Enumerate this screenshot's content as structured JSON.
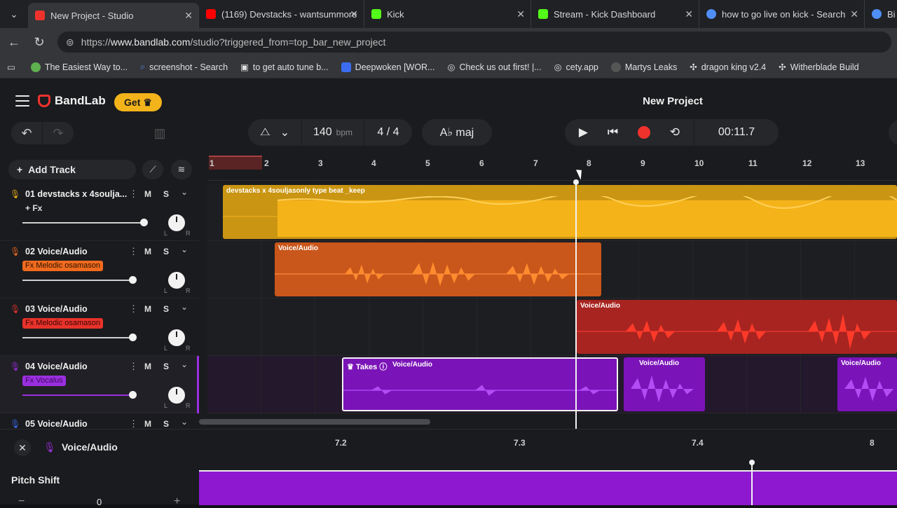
{
  "browser": {
    "tabs": [
      {
        "title": "New Project - Studio",
        "color": "#f0322d"
      },
      {
        "title": "(1169) Devstacks - wantsummore",
        "color": "#ff0000"
      },
      {
        "title": "Kick",
        "color": "#53fc18"
      },
      {
        "title": "Stream - Kick Dashboard",
        "color": "#53fc18"
      },
      {
        "title": "how to go live on kick - Search",
        "color": "#4f8ef7"
      },
      {
        "title": "Bi",
        "color": "#4f8ef7"
      }
    ],
    "url_prefix": "https://",
    "url_host": "www.bandlab.com",
    "url_path": "/studio?triggered_from=top_bar_new_project",
    "bookmarks": [
      {
        "label": "The Easiest Way to...",
        "color": "#5fb04f"
      },
      {
        "label": "screenshot - Search",
        "color": "#4f8ef7"
      },
      {
        "label": "to get auto tune b...",
        "color": "#cfcfcf"
      },
      {
        "label": "Deepwoken [WOR...",
        "color": "#3b6cf0"
      },
      {
        "label": "Check us out first! |...",
        "color": "#cfcfcf"
      },
      {
        "label": "cety.app",
        "color": "#cfcfcf"
      },
      {
        "label": "Martys Leaks",
        "color": "#555555"
      },
      {
        "label": "dragon king v2.4",
        "color": "#888888"
      },
      {
        "label": "Witherblade Build",
        "color": "#888888"
      }
    ]
  },
  "header": {
    "brand": "BandLab",
    "get_label": "Get",
    "project_title": "New Project",
    "bpm": "140",
    "bpm_unit": "bpm",
    "time_signature": "4 / 4",
    "key": "A♭ maj",
    "time": "00:11.7"
  },
  "tracks_panel": {
    "add_track": "Add Track",
    "m_label": "M",
    "s_label": "S",
    "tracks": [
      {
        "name": "01  devstacks x 4soulja...",
        "fx": "+ Fx",
        "color": "#f3b41b"
      },
      {
        "name": "02  Voice/Audio",
        "fx": "Fx  Melodic osamason",
        "color": "#f06a1e"
      },
      {
        "name": "03  Voice/Audio",
        "fx": "Fx  Melodic osamason",
        "color": "#e8322a"
      },
      {
        "name": "04  Voice/Audio",
        "fx": "Fx  Vocalus",
        "color": "#9b2fe0"
      },
      {
        "name": "05  Voice/Audio",
        "fx": "",
        "color": "#3b6cf0"
      }
    ],
    "lr_left": "L",
    "lr_right": "R"
  },
  "ruler": {
    "ticks": [
      "1",
      "2",
      "3",
      "4",
      "5",
      "6",
      "7",
      "8",
      "9",
      "10",
      "11",
      "12",
      "13"
    ]
  },
  "clips": {
    "beat_label": "devstacks x 4souljasonly type beat _keep",
    "voice2_label": "Voice/Audio",
    "voice3_label": "Voice/Audio",
    "takes_label": "Takes",
    "voice4a_label": "Voice/Audio",
    "voice4b_label": "Voice/Audio",
    "voice4c_label": "Voice/Audio"
  },
  "editor": {
    "title": "Voice/Audio",
    "pitch_label": "Pitch Shift",
    "pitch_value": "0",
    "minus": "−",
    "plus": "+",
    "ticks": [
      "7.2",
      "7.3",
      "7.4",
      "8"
    ]
  }
}
